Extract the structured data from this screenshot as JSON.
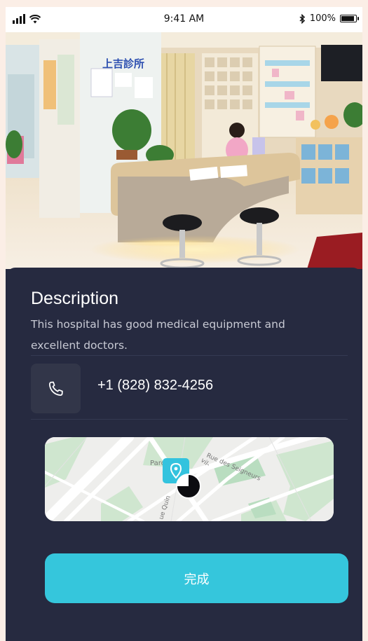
{
  "status_bar": {
    "time": "9:41 AM",
    "battery": "100%",
    "battery_level": 1.0,
    "icons": [
      "signal-icon",
      "wifi-icon",
      "bluetooth-icon",
      "battery-icon"
    ]
  },
  "hero": {
    "image": "clinic-reception-photo",
    "sign_text": "上吉診所"
  },
  "description": {
    "title": "Description",
    "body": "This hospital has good medical equipment and excellent doctors."
  },
  "contact": {
    "icon": "phone-icon",
    "phone": "+1 (828) 832-4256"
  },
  "map": {
    "street_1": "Rue des Seigneurs",
    "street_2": "Parc",
    "street_3": "ue Quin",
    "street_4": "vil-",
    "marker_icon": "location-pin-icon"
  },
  "actions": {
    "done_label": "完成"
  },
  "colors": {
    "sheet_bg": "#262a40",
    "accent": "#35c6dc",
    "text_primary": "#ffffff",
    "text_secondary": "#c8cad4"
  }
}
